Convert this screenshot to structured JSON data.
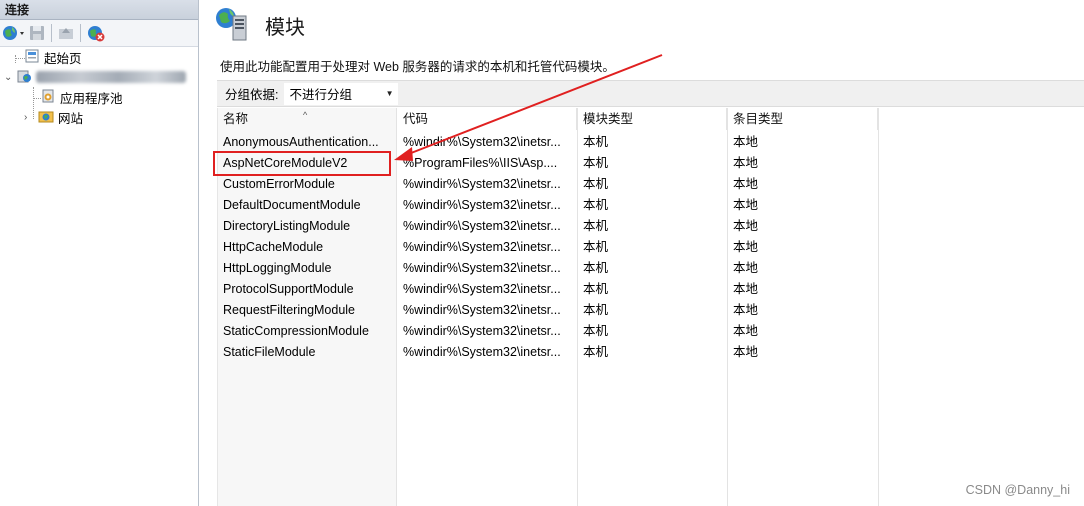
{
  "connections": {
    "header": "连接",
    "toolbar": [
      "globe-dropdown-icon",
      "save-icon",
      "connect-icon",
      "disconnect-icon"
    ],
    "tree": [
      {
        "label": "起始页",
        "icon": "start-page-icon"
      },
      {
        "label": "",
        "icon": "server-icon"
      },
      {
        "label": "应用程序池",
        "icon": "app-pools-icon"
      },
      {
        "label": "网站",
        "icon": "sites-icon"
      }
    ]
  },
  "main": {
    "title": "模块",
    "description": "使用此功能配置用于处理对 Web 服务器的请求的本机和托管代码模块。",
    "group_by_label": "分组依据:",
    "group_by_value": "不进行分组",
    "columns": [
      "名称",
      "代码",
      "模块类型",
      "条目类型"
    ],
    "rows": [
      [
        "AnonymousAuthentication...",
        "%windir%\\System32\\inetsr...",
        "本机",
        "本地"
      ],
      [
        "AspNetCoreModuleV2",
        "%ProgramFiles%\\IIS\\Asp....",
        "本机",
        "本地"
      ],
      [
        "CustomErrorModule",
        "%windir%\\System32\\inetsr...",
        "本机",
        "本地"
      ],
      [
        "DefaultDocumentModule",
        "%windir%\\System32\\inetsr...",
        "本机",
        "本地"
      ],
      [
        "DirectoryListingModule",
        "%windir%\\System32\\inetsr...",
        "本机",
        "本地"
      ],
      [
        "HttpCacheModule",
        "%windir%\\System32\\inetsr...",
        "本机",
        "本地"
      ],
      [
        "HttpLoggingModule",
        "%windir%\\System32\\inetsr...",
        "本机",
        "本地"
      ],
      [
        "ProtocolSupportModule",
        "%windir%\\System32\\inetsr...",
        "本机",
        "本地"
      ],
      [
        "RequestFilteringModule",
        "%windir%\\System32\\inetsr...",
        "本机",
        "本地"
      ],
      [
        "StaticCompressionModule",
        "%windir%\\System32\\inetsr...",
        "本机",
        "本地"
      ],
      [
        "StaticFileModule",
        "%windir%\\System32\\inetsr...",
        "本机",
        "本地"
      ]
    ]
  },
  "annotation": {
    "color": "#e02020"
  },
  "watermark": "CSDN @Danny_hi"
}
